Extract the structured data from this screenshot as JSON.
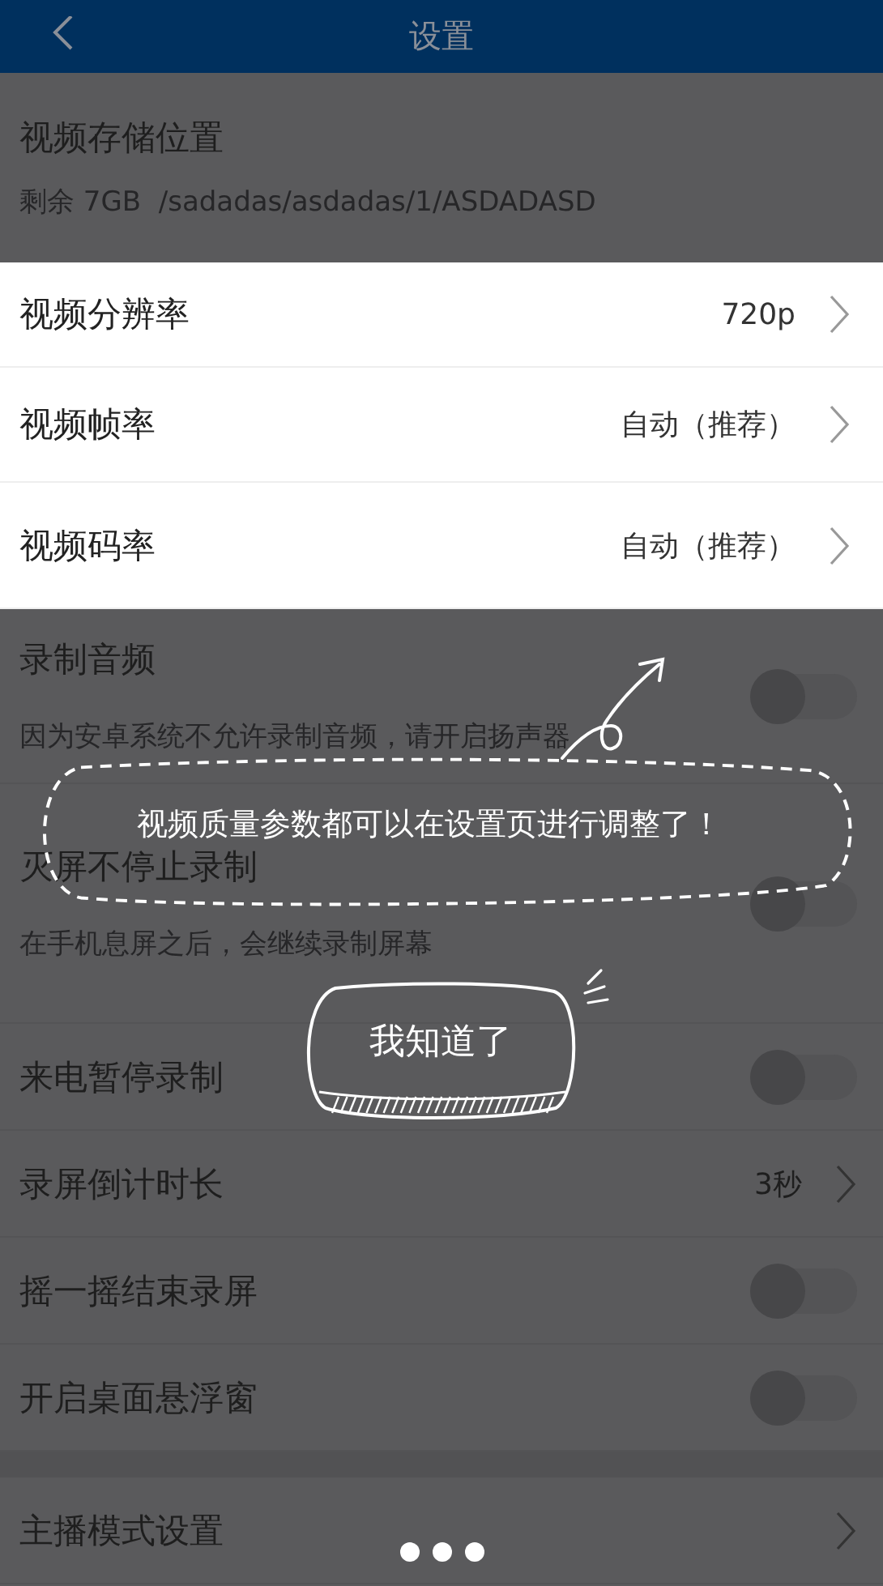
{
  "header": {
    "title": "设置"
  },
  "storage": {
    "title": "视频存储位置",
    "detail": "剩余 7GB  /sadadas/asdadas/1/ASDADASD"
  },
  "highlighted_rows": [
    {
      "label": "视频分辨率",
      "value": "720p"
    },
    {
      "label": "视频帧率",
      "value": "自动（推荐）"
    },
    {
      "label": "视频码率",
      "value": "自动（推荐）"
    }
  ],
  "settings": [
    {
      "kind": "toggle",
      "label": "录制音频",
      "description": "因为安卓系统不允许录制音频，请开启扬声器",
      "on": false
    },
    {
      "kind": "toggle",
      "label": "灭屏不停止录制",
      "description": "在手机息屏之后，会继续录制屏幕",
      "on": false
    },
    {
      "kind": "toggle",
      "label": "来电暂停录制",
      "on": false
    },
    {
      "kind": "link",
      "label": "录屏倒计时长",
      "value": "3秒"
    },
    {
      "kind": "toggle",
      "label": "摇一摇结束录屏",
      "on": false
    },
    {
      "kind": "toggle",
      "label": "开启桌面悬浮窗",
      "on": false
    },
    {
      "kind": "gap"
    },
    {
      "kind": "link",
      "label": "主播模式设置"
    }
  ],
  "tip": {
    "message": "视频质量参数都可以在设置页进行调整了！",
    "button": "我知道了"
  }
}
